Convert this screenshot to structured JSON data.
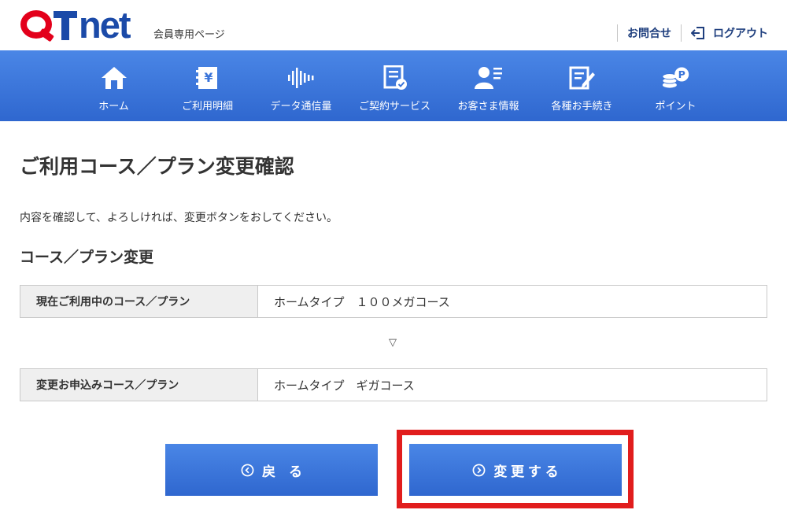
{
  "header": {
    "logo_text": "net",
    "subtitle": "会員専用ページ",
    "contact_label": "お問合せ",
    "logout_label": "ログアウト"
  },
  "nav": {
    "items": [
      {
        "label": "ホーム",
        "icon": "home-icon"
      },
      {
        "label": "ご利用明細",
        "icon": "billing-statement-icon"
      },
      {
        "label": "データ通信量",
        "icon": "data-usage-icon"
      },
      {
        "label": "ご契約サービス",
        "icon": "contract-service-icon"
      },
      {
        "label": "お客さま情報",
        "icon": "customer-info-icon"
      },
      {
        "label": "各種お手続き",
        "icon": "procedures-icon"
      },
      {
        "label": "ポイント",
        "icon": "points-icon"
      }
    ]
  },
  "main": {
    "page_title": "ご利用コース／プラン変更確認",
    "intro": "内容を確認して、よろしければ、変更ボタンをおしてください。",
    "section_title": "コース／プラン変更",
    "current_label": "現在ご利用中のコース／プラン",
    "current_value": "ホームタイプ　１００メガコース",
    "arrow": "▽",
    "new_label": "変更お申込みコース／プラン",
    "new_value": "ホームタイプ　ギガコース"
  },
  "buttons": {
    "back_label": "戻　る",
    "change_label": "変 更 す る"
  },
  "colors": {
    "brand_red": "#e3001b",
    "brand_blue": "#1b4aa8",
    "nav_blue": "#3a74d9",
    "highlight": "#e11d1d"
  }
}
